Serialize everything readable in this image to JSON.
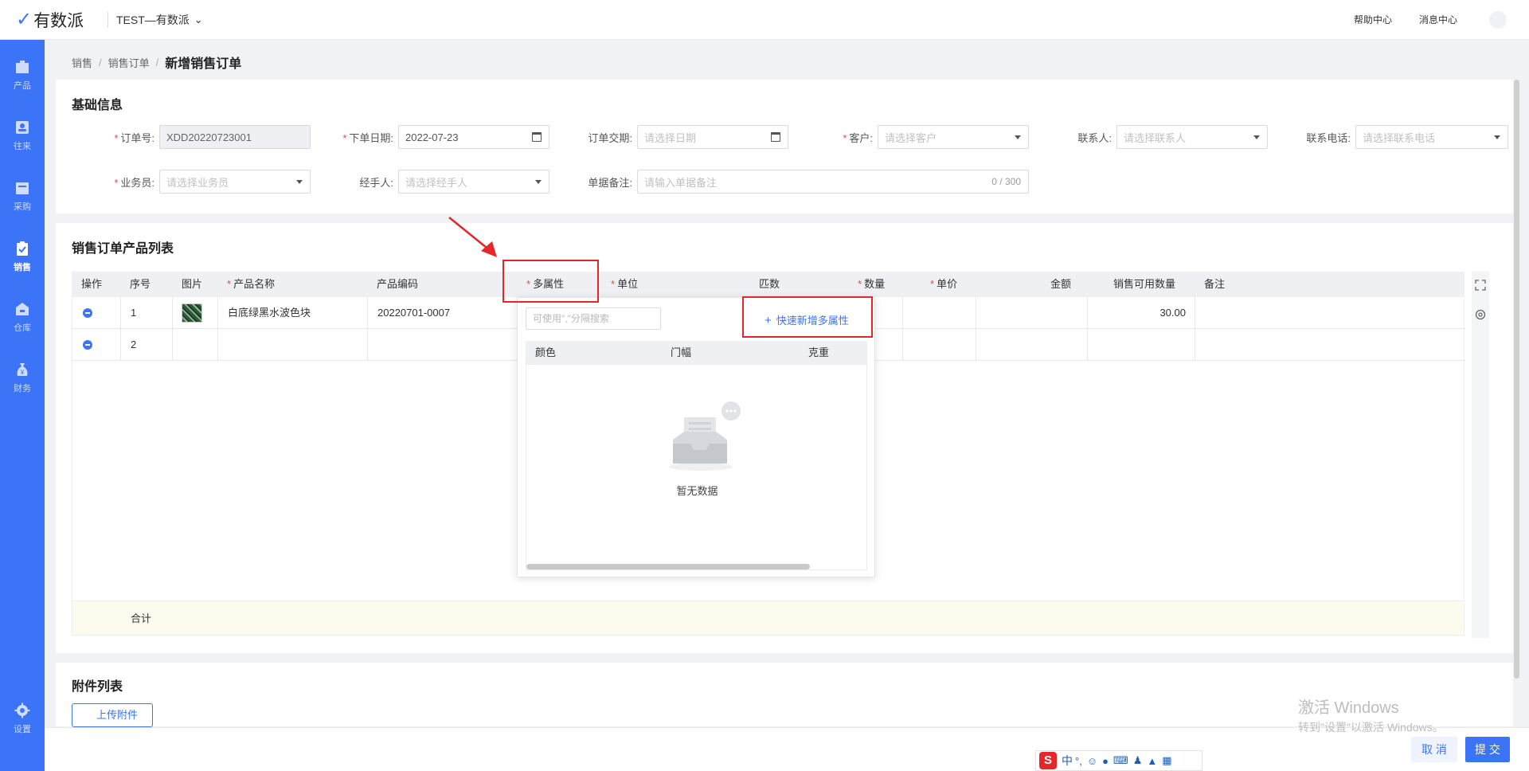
{
  "app": {
    "name": "有数派",
    "org": "TEST—有数派"
  },
  "topbar": {
    "help": "帮助中心",
    "messages": "消息中心"
  },
  "sidebar": {
    "items": [
      {
        "label": "产品"
      },
      {
        "label": "往来"
      },
      {
        "label": "采购"
      },
      {
        "label": "销售",
        "active": true
      },
      {
        "label": "仓库"
      },
      {
        "label": "财务"
      }
    ],
    "settings": "设置"
  },
  "breadcrumb": {
    "l1": "销售",
    "l2": "销售订单",
    "current": "新增销售订单"
  },
  "basic": {
    "title": "基础信息",
    "order_no": {
      "label": "订单号:",
      "value": "XDD20220723001"
    },
    "order_date": {
      "label": "下单日期:",
      "value": "2022-07-23"
    },
    "delivery_date": {
      "label": "订单交期:",
      "placeholder": "请选择日期"
    },
    "customer": {
      "label": "客户:",
      "placeholder": "请选择客户"
    },
    "contact": {
      "label": "联系人:",
      "placeholder": "请选择联系人"
    },
    "phone": {
      "label": "联系电话:",
      "placeholder": "请选择联系电话"
    },
    "salesman": {
      "label": "业务员:",
      "placeholder": "请选择业务员"
    },
    "handler": {
      "label": "经手人:",
      "placeholder": "请选择经手人"
    },
    "remark": {
      "label": "单据备注:",
      "placeholder": "请输入单据备注",
      "count": "0 / 300"
    }
  },
  "products": {
    "title": "销售订单产品列表",
    "columns": {
      "op": "操作",
      "seq": "序号",
      "img": "图片",
      "name": "产品名称",
      "code": "产品编码",
      "attr": "多属性",
      "unit": "单位",
      "pieces": "匹数",
      "qty": "数量",
      "price": "单价",
      "amount": "金额",
      "avail": "销售可用数量",
      "note": "备注"
    },
    "rows": [
      {
        "seq": "1",
        "name": "白底绿黑水波色块",
        "code": "20220701-0007",
        "avail": "30.00"
      },
      {
        "seq": "2",
        "name": "",
        "code": "",
        "avail": ""
      }
    ],
    "total_label": "合计"
  },
  "attr_popup": {
    "search_placeholder": "可使用\",\"分隔搜索",
    "quick_add": "快速新增多属性",
    "columns": [
      "颜色",
      "门幅",
      "克重"
    ],
    "empty": "暂无数据"
  },
  "attachments": {
    "title": "附件列表",
    "upload": "上传附件"
  },
  "footer": {
    "cancel": "取 消",
    "submit": "提 交"
  },
  "watermark": {
    "line1": "激活 Windows",
    "line2": "转到\"设置\"以激活 Windows。"
  },
  "ime": {
    "mode": "中"
  }
}
